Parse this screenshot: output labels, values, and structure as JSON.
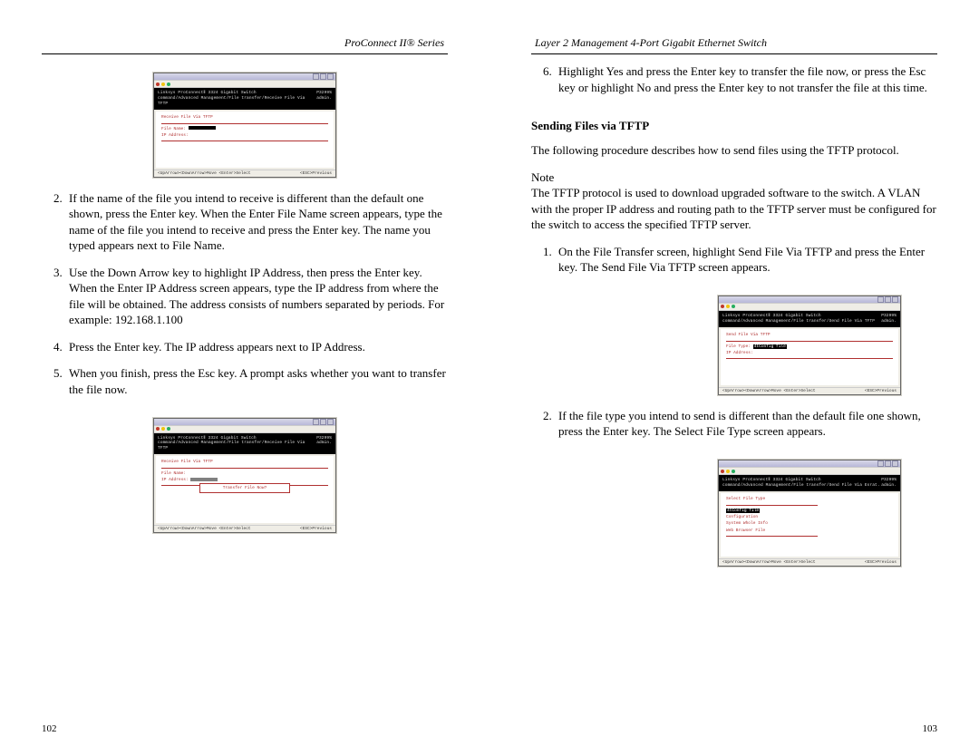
{
  "headers": {
    "left": "ProConnect II® Series",
    "right": "Layer 2 Management 4-Port Gigabit Ethernet Switch"
  },
  "left_page": {
    "figure1": {
      "dark_line1": "Linksys ProConnectⅡ 3324 Gigabit Switch",
      "dark_line2": "command/Advanced Management/File transfer/Receive File Via TFTP",
      "dark_right1": "P3299%",
      "dark_right2": "admin.",
      "content_heading": "Receive File Via TFTP",
      "field1_label": "File Name:",
      "field2_label": "IP Address:",
      "status_left": "<UpArrow><DownArrow>Move  <Enter>Select",
      "status_right": "<ESC>Previous"
    },
    "list_start": 2,
    "items": [
      "If the name of the file you intend to receive is different than the default one shown, press the Enter key. When the Enter File Name screen appears, type the name of the file you intend to receive and press the Enter key. The name you typed appears next to File Name.",
      "Use the Down Arrow key to highlight IP Address, then press the Enter key. When the Enter IP Address screen appears, type the IP address from where the file will be obtained. The address consists of numbers separated by periods. For example: 192.168.1.100",
      "Press the Enter key. The IP address appears next to IP Address.",
      "When you finish, press the Esc key. A prompt asks whether you want to transfer the file now."
    ],
    "figure2": {
      "dark_line1": "Linksys ProConnectⅡ 3324 Gigabit Switch",
      "dark_line2": "command/Advanced Management/File transfer/Receive File Via TFTP",
      "dark_right1": "P3299%",
      "dark_right2": "admin.",
      "content_heading": "Receive File Via TFTP",
      "field1_label": "File Name:",
      "field2_label": "IP Address:",
      "dialog_text": "Transfer File Now?",
      "status_left": "<UpArrow><DownArrow>Move  <Enter>Select",
      "status_right": "<ESC>Previous"
    },
    "page_number": "102"
  },
  "right_page": {
    "top_list_start": 6,
    "top_items": [
      "Highlight Yes and press the Enter key to transfer the file now, or press the Esc key or highlight No and press the Enter key to not transfer the file at this time."
    ],
    "section_title": "Sending Files via TFTP",
    "intro": "The following procedure describes how to send files using the TFTP protocol.",
    "note_label": "Note",
    "note_body": "The TFTP protocol is used to download upgraded software to the switch. A VLAN with the proper IP address and routing path to the TFTP server must be configured for the switch to access the specified TFTP server.",
    "mid_list_start": 1,
    "mid_items": [
      "On the File Transfer screen, highlight Send File Via TFTP and press the Enter key. The Send File Via TFTP screen appears."
    ],
    "figure3": {
      "dark_line1": "Linksys ProConnectⅡ 3324 Gigabit Switch",
      "dark_line2": "command/Advanced Management/File transfer/Send File Via TFTP",
      "dark_right1": "P3299%",
      "dark_right2": "admin.",
      "content_heading": "Send File Via TFTP",
      "field1_label": "File Type:",
      "field2_label": "IP Address:",
      "field1_value": "4tConfig file",
      "status_left": "<UpArrow><DownArrow>Move  <Enter>Select",
      "status_right": "<ESC>Previous"
    },
    "after_fig3_list_start": 2,
    "after_fig3_items": [
      "If the file type you intend to send is different than the default file one shown, press the Enter key. The Select File Type screen appears."
    ],
    "figure4": {
      "dark_line1": "Linksys ProConnectⅡ 3324 Gigabit Switch",
      "dark_line2": "command/Advanced Management/File transfer/Send File Via Esrat.",
      "dark_right1": "P3299%",
      "dark_right2": "admin.",
      "content_heading": "Select File Type",
      "menu": [
        "4tConfig file",
        "Configuration",
        "System Whole Info",
        "Web Browser File"
      ],
      "status_left": "<UpArrow><DownArrow>Move  <Enter>Select",
      "status_right": "<ESC>Previous"
    },
    "page_number": "103"
  }
}
